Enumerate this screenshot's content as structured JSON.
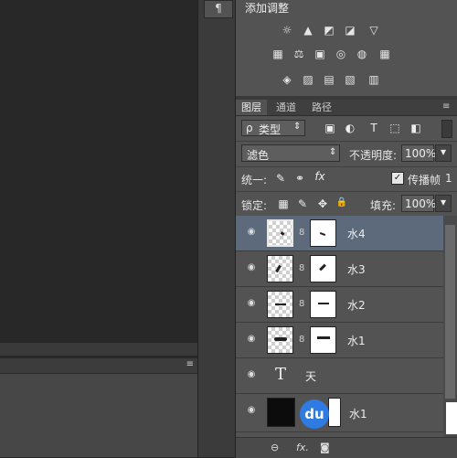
{
  "dock": {
    "paragraph_symbol": "¶"
  },
  "lower_panel": {
    "menu_icon": "≡"
  },
  "adjustments": {
    "title": "添加调整",
    "icons_row1": [
      "☼",
      "▲",
      "◩",
      "◪",
      "▽"
    ],
    "icons_row2": [
      "▦",
      "⚖",
      "▣",
      "◎",
      "◍",
      "▦"
    ],
    "icons_row3": [
      "◈",
      "▨",
      "▤",
      "▧",
      "▥"
    ]
  },
  "layers_panel": {
    "tabs": [
      "图层",
      "通道",
      "路径"
    ],
    "menu_icon": "≡",
    "filter": {
      "search_icon": "ρ",
      "label": "类型",
      "arrow": "⇕"
    },
    "filter_icons": [
      "▣",
      "◐",
      "T",
      "⬚",
      "◧"
    ],
    "blend_mode": "滤色",
    "blend_arrow": "⇕",
    "opacity_label": "不透明度:",
    "opacity_value": "100%",
    "unify_label": "统一:",
    "unify_icons": [
      "✎",
      "⚭",
      "fx"
    ],
    "propagate_label": "传播帧",
    "propagate_value": "1",
    "lock_label": "锁定:",
    "lock_icons": [
      "▦",
      "✎",
      "✥",
      "🔒"
    ],
    "fill_label": "填充:",
    "fill_value": "100%",
    "dropdown_arrow": "▾",
    "layers": [
      {
        "name": "水4"
      },
      {
        "name": "水3"
      },
      {
        "name": "水2"
      },
      {
        "name": "水1"
      },
      {
        "name": "天",
        "type_icon": "T"
      },
      {
        "name": "水1"
      }
    ],
    "bottom_icons": [
      "⊖",
      "fx.",
      "◙"
    ]
  },
  "watermark": {
    "text": "du"
  }
}
